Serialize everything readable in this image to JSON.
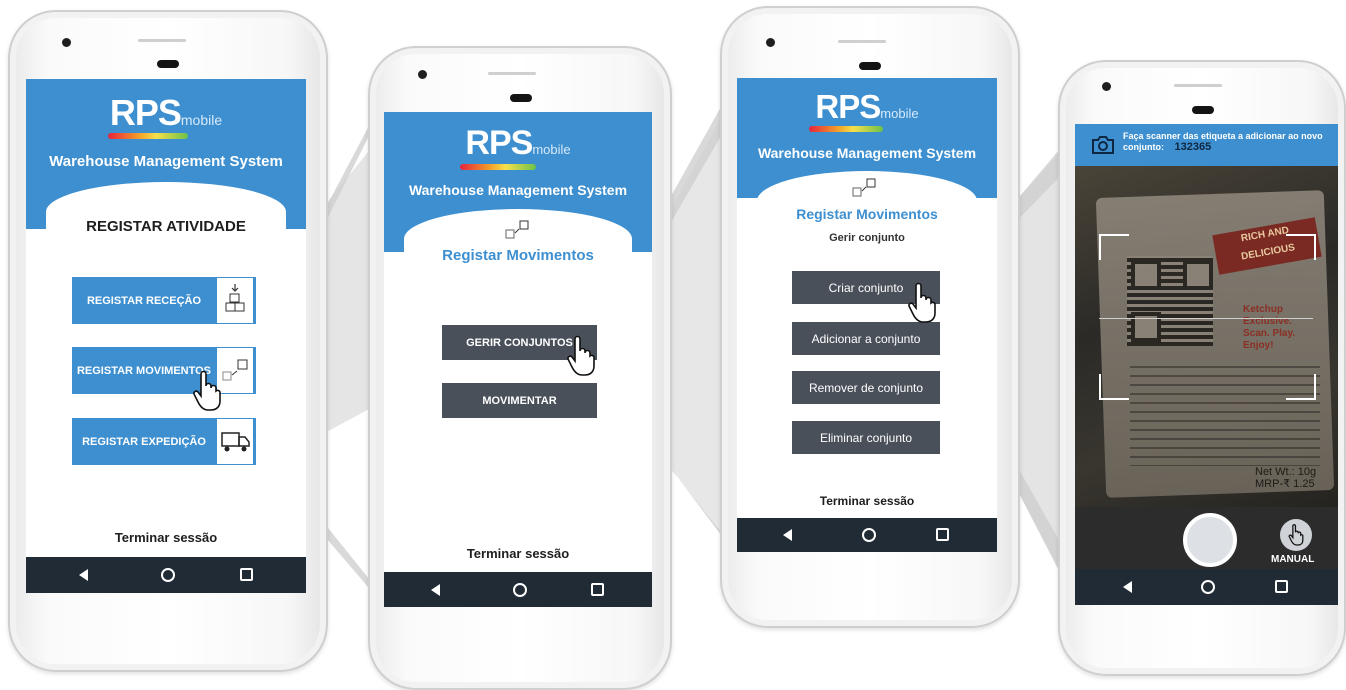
{
  "brand": {
    "logo_main": "RPS",
    "logo_sub": "mobile",
    "subtitle": "Warehouse Management System"
  },
  "screen1": {
    "title": "REGISTAR ATIVIDADE",
    "buttons": [
      {
        "label": "REGISTAR RECEÇÃO",
        "icon": "boxes-down-icon"
      },
      {
        "label": "REGISTAR MOVIMENTOS",
        "icon": "boxes-move-icon"
      },
      {
        "label": "REGISTAR EXPEDIÇÃO",
        "icon": "truck-icon"
      }
    ],
    "logout": "Terminar sessão"
  },
  "screen2": {
    "title": "Registar Movimentos",
    "buttons": [
      "GERIR CONJUNTOS",
      "MOVIMENTAR"
    ],
    "logout": "Terminar sessão"
  },
  "screen3": {
    "title": "Registar Movimentos",
    "subtitle": "Gerir conjunto",
    "buttons": [
      "Criar conjunto",
      "Adicionar a conjunto",
      "Remover de conjunto",
      "Eliminar conjunto"
    ],
    "logout": "Terminar sessão"
  },
  "screen4": {
    "instruction": "Faça scanner das etiqueta a adicionar ao novo conjunto:",
    "code": "132365",
    "manual_label": "MANUAL",
    "photo_text": {
      "l1": "RICH AND",
      "l2": "DELICIOUS",
      "l3": "Ketchup",
      "l4": "Exclusive.",
      "l5": "Scan. Play.",
      "l6": "Enjoy!",
      "net": "Net Wt.: 10g",
      "mrp": "MRP-₹ 1.25"
    }
  },
  "colors": {
    "accent": "#3d8fd0",
    "dark_button": "#4a505a",
    "navbar": "#212b36"
  }
}
